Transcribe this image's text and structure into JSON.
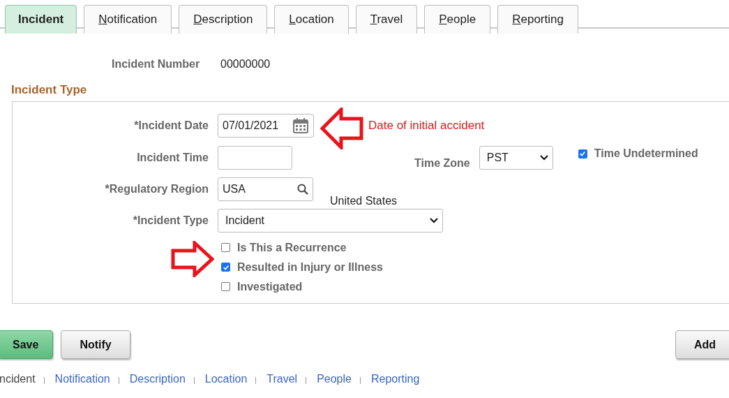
{
  "tabs": [
    {
      "label": "Incident",
      "selected": true
    },
    {
      "label": "Notification",
      "selected": false
    },
    {
      "label": "Description",
      "selected": false
    },
    {
      "label": "Location",
      "selected": false
    },
    {
      "label": "Travel",
      "selected": false
    },
    {
      "label": "People",
      "selected": false
    },
    {
      "label": "Reporting",
      "selected": false
    }
  ],
  "incident_number": {
    "label": "Incident Number",
    "value": "00000000"
  },
  "section_title": "Incident Type",
  "incident_date": {
    "label": "*Incident Date",
    "value": "07/01/2021"
  },
  "incident_time": {
    "label": "Incident Time"
  },
  "time_zone": {
    "label": "Time Zone",
    "value": "PST"
  },
  "time_undetermined": {
    "label": "Time Undetermined",
    "checked": true
  },
  "regulatory_region": {
    "label": "*Regulatory Region",
    "value": "USA",
    "description": "United States"
  },
  "incident_type": {
    "label": "*Incident Type",
    "value": "Incident"
  },
  "checkboxes": [
    {
      "label": "Is This a Recurrence",
      "checked": false
    },
    {
      "label": "Resulted in Injury or Illness",
      "checked": true
    },
    {
      "label": "Investigated",
      "checked": false
    }
  ],
  "annotation": "Date of initial accident",
  "buttons": {
    "save": "Save",
    "notify": "Notify",
    "add": "Add"
  },
  "links": [
    {
      "label": "ncident",
      "selected": true
    },
    {
      "label": "Notification",
      "selected": false
    },
    {
      "label": "Description",
      "selected": false
    },
    {
      "label": "Location",
      "selected": false
    },
    {
      "label": "Travel",
      "selected": false
    },
    {
      "label": "People",
      "selected": false
    },
    {
      "label": "Reporting",
      "selected": false
    }
  ]
}
